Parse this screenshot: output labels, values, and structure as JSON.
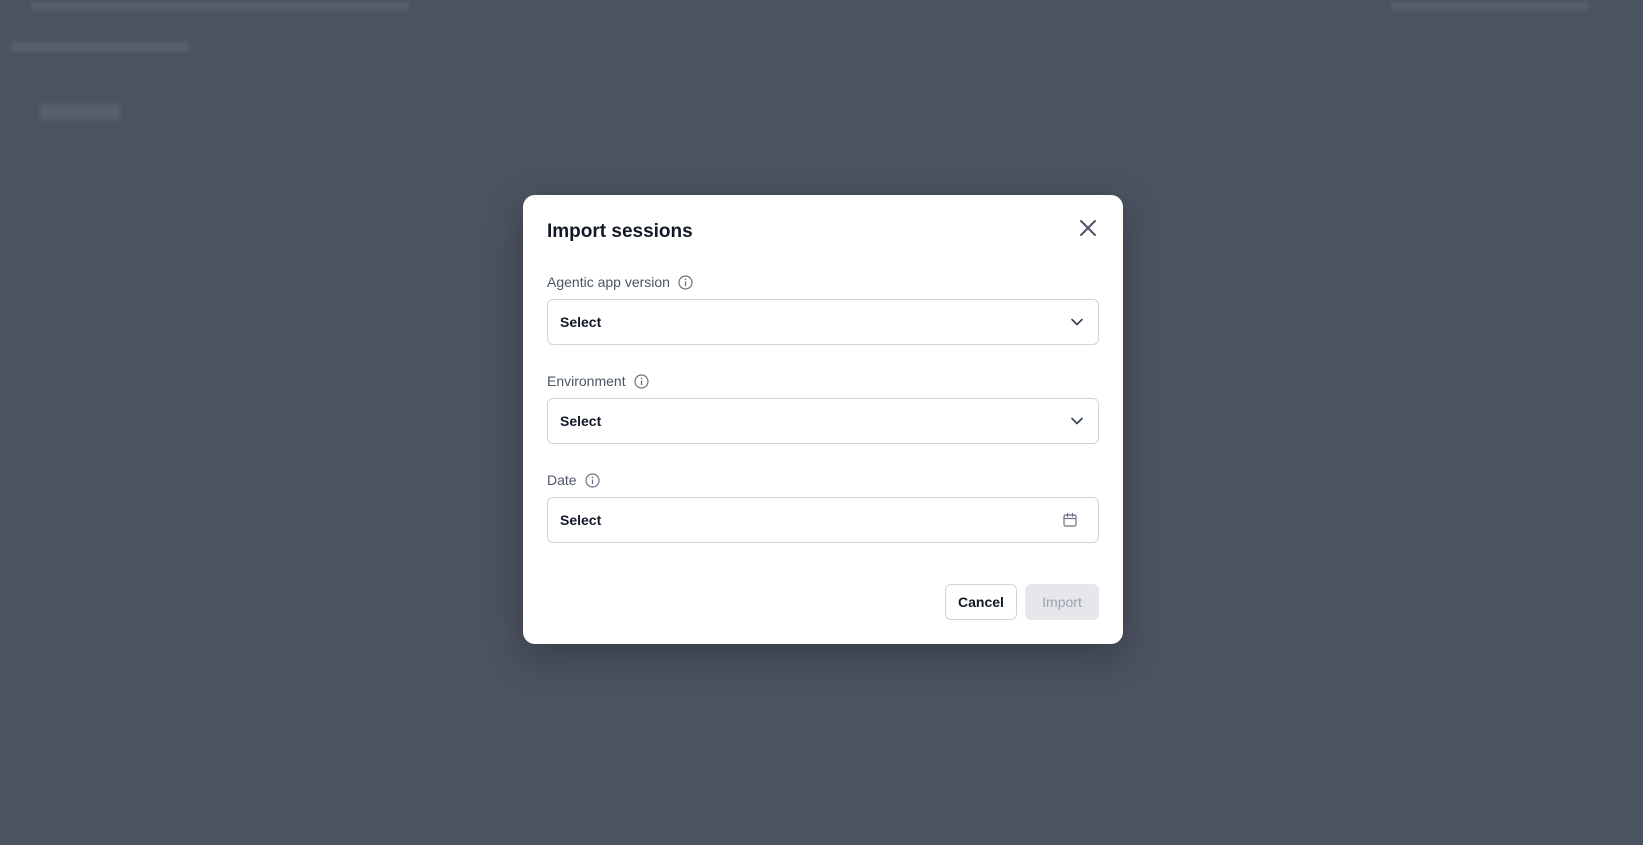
{
  "modal": {
    "title": "Import sessions",
    "close_icon": "close-icon"
  },
  "fields": {
    "app_version": {
      "label": "Agentic app version",
      "value": "Select",
      "icon": "chevron-down-icon"
    },
    "environment": {
      "label": "Environment",
      "value": "Select",
      "icon": "chevron-down-icon"
    },
    "date": {
      "label": "Date",
      "value": "Select",
      "icon": "calendar-icon"
    }
  },
  "actions": {
    "cancel_label": "Cancel",
    "import_label": "Import"
  },
  "colors": {
    "overlay": "#4b5260",
    "disabled_button": "#e5e7eb"
  }
}
